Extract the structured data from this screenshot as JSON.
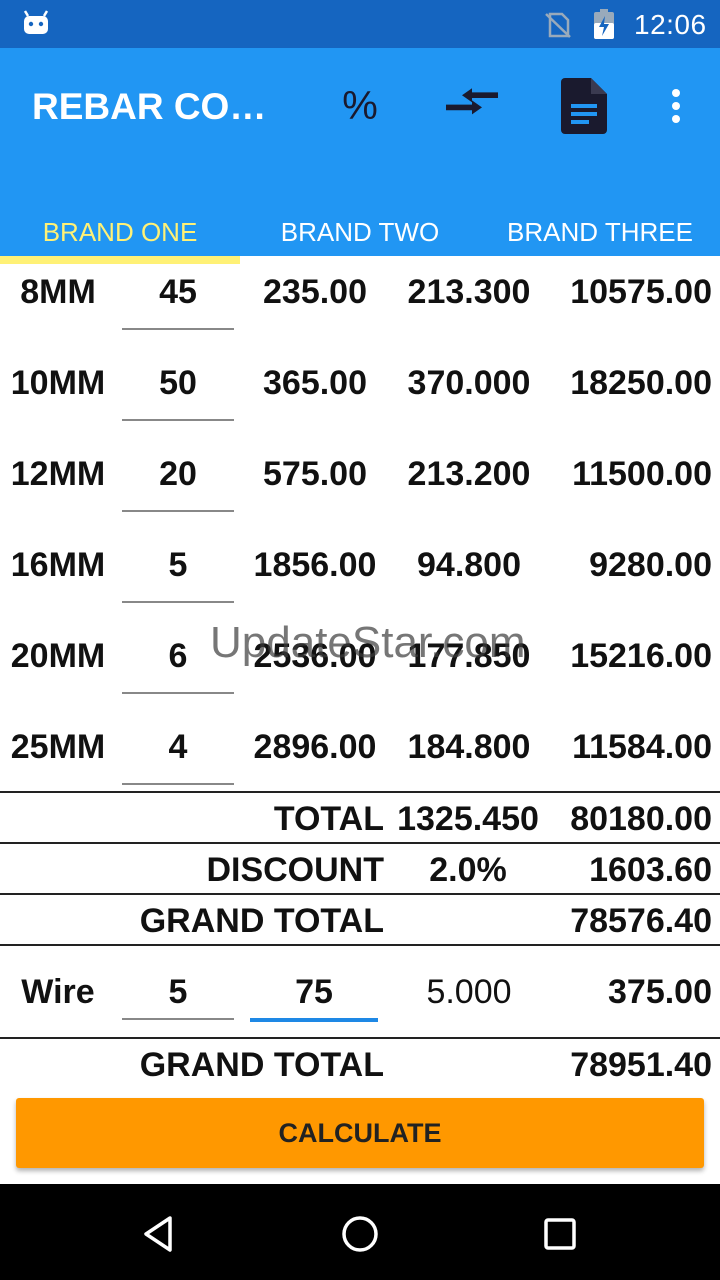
{
  "status_bar": {
    "time": "12:06"
  },
  "app_bar": {
    "title": "REBAR COS…",
    "percent_glyph": "%",
    "tabs": [
      {
        "label": "BRAND ONE",
        "active": true
      },
      {
        "label": "BRAND TWO",
        "active": false
      },
      {
        "label": "BRAND THREE",
        "active": false
      }
    ]
  },
  "rows": [
    {
      "size": "8MM",
      "qty": "45",
      "price": "235.00",
      "weight": "213.300",
      "amount": "10575.00"
    },
    {
      "size": "10MM",
      "qty": "50",
      "price": "365.00",
      "weight": "370.000",
      "amount": "18250.00"
    },
    {
      "size": "12MM",
      "qty": "20",
      "price": "575.00",
      "weight": "213.200",
      "amount": "11500.00"
    },
    {
      "size": "16MM",
      "qty": "5",
      "price": "1856.00",
      "weight": "94.800",
      "amount": "9280.00"
    },
    {
      "size": "20MM",
      "qty": "6",
      "price": "2536.00",
      "weight": "177.850",
      "amount": "15216.00"
    },
    {
      "size": "25MM",
      "qty": "4",
      "price": "2896.00",
      "weight": "184.800",
      "amount": "11584.00"
    }
  ],
  "totals": {
    "total_label": "TOTAL",
    "total_weight": "1325.450",
    "total_amount": "80180.00",
    "discount_label": "DISCOUNT",
    "discount_pct": "2.0%",
    "discount_amount": "1603.60",
    "grand_total_label": "GRAND TOTAL",
    "grand_total_amount": "78576.40"
  },
  "wire": {
    "label": "Wire",
    "qty": "5",
    "price": "75",
    "weight": "5.000",
    "amount": "375.00"
  },
  "final": {
    "grand_total_label": "GRAND TOTAL",
    "grand_total_amount": "78951.40"
  },
  "watermark": "UpdateStar.com",
  "calculate_label": "CALCULATE",
  "colors": {
    "status_bar": "#1565c0",
    "app_bar": "#2196f3",
    "active_tab": "#fff176",
    "button": "#ff9800"
  }
}
